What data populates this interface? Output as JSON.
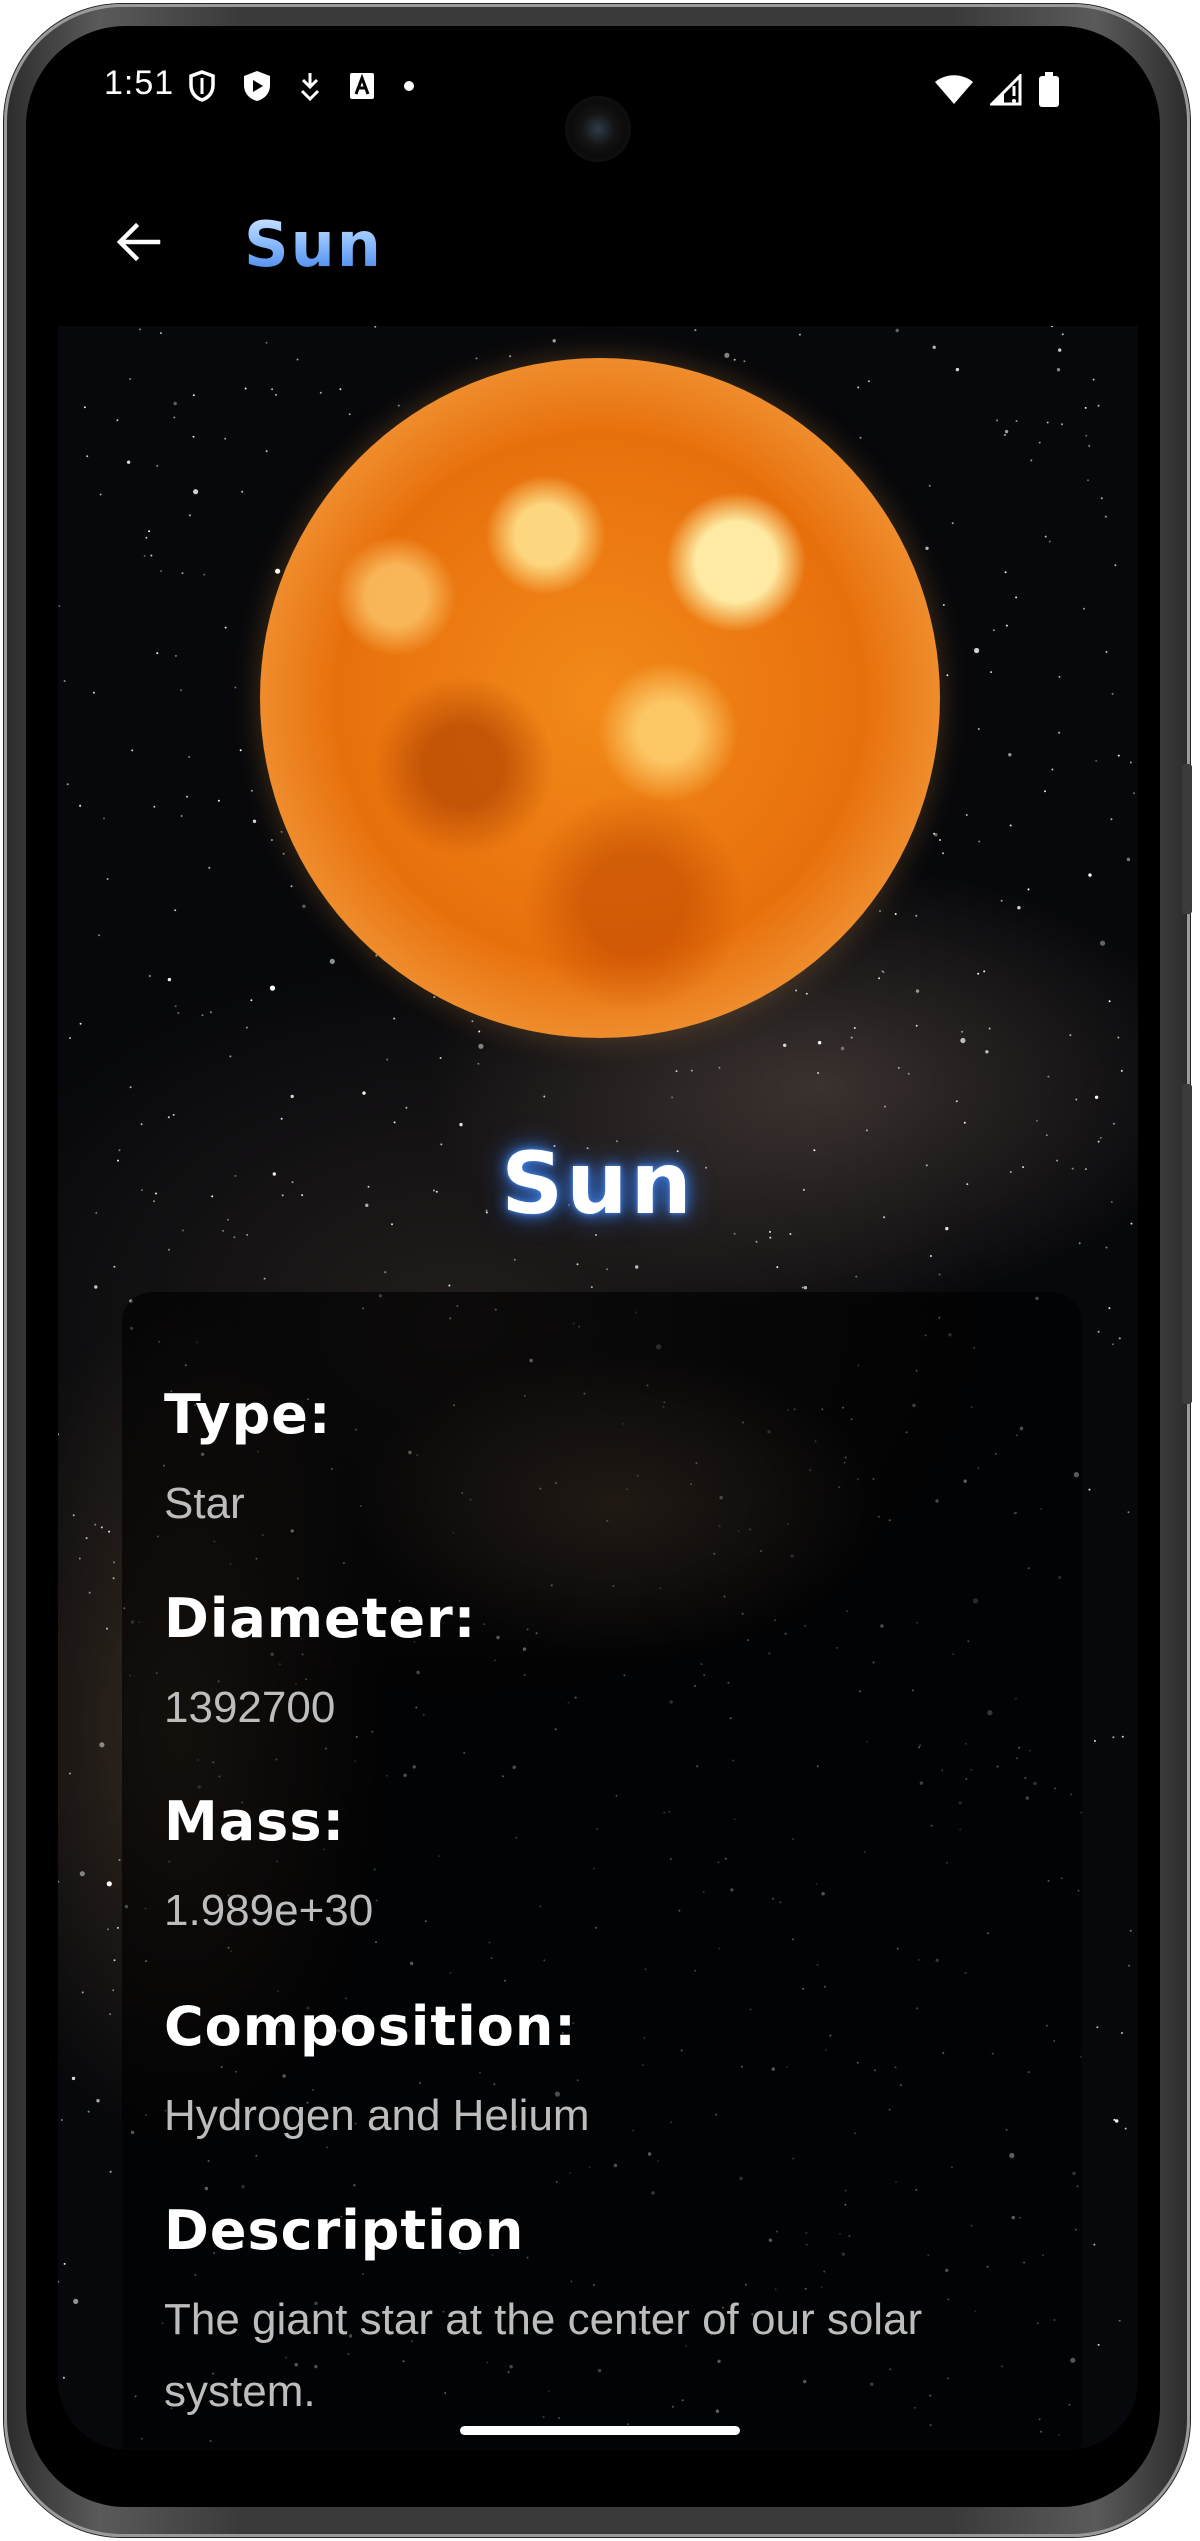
{
  "status_bar": {
    "time": "1:51",
    "left_icons": [
      "shield-icon",
      "play-shield-icon",
      "download-arrow-icon",
      "text-a-icon",
      "dot-icon"
    ],
    "right_icons": [
      "wifi-icon",
      "signal-icon",
      "battery-icon"
    ]
  },
  "app_bar": {
    "title": "Sun",
    "back_icon": "arrow-left-icon"
  },
  "planet": {
    "name": "Sun",
    "image": "sun-illustration"
  },
  "details": [
    {
      "label": "Type:",
      "value": "Star"
    },
    {
      "label": "Diameter:",
      "value": "1392700"
    },
    {
      "label": "Mass:",
      "value": "1.989e+30"
    },
    {
      "label": "Composition:",
      "value": "Hydrogen and Helium"
    },
    {
      "label": "Description",
      "value": "The giant star at the center of our solar system."
    }
  ],
  "colors": {
    "title_gradient_light": "#dfeeff",
    "title_gradient_dark": "#3b7be8",
    "glow": "#3b7ce0",
    "label": "#ffffff",
    "value": "#bdbdbd",
    "background": "#000000"
  }
}
